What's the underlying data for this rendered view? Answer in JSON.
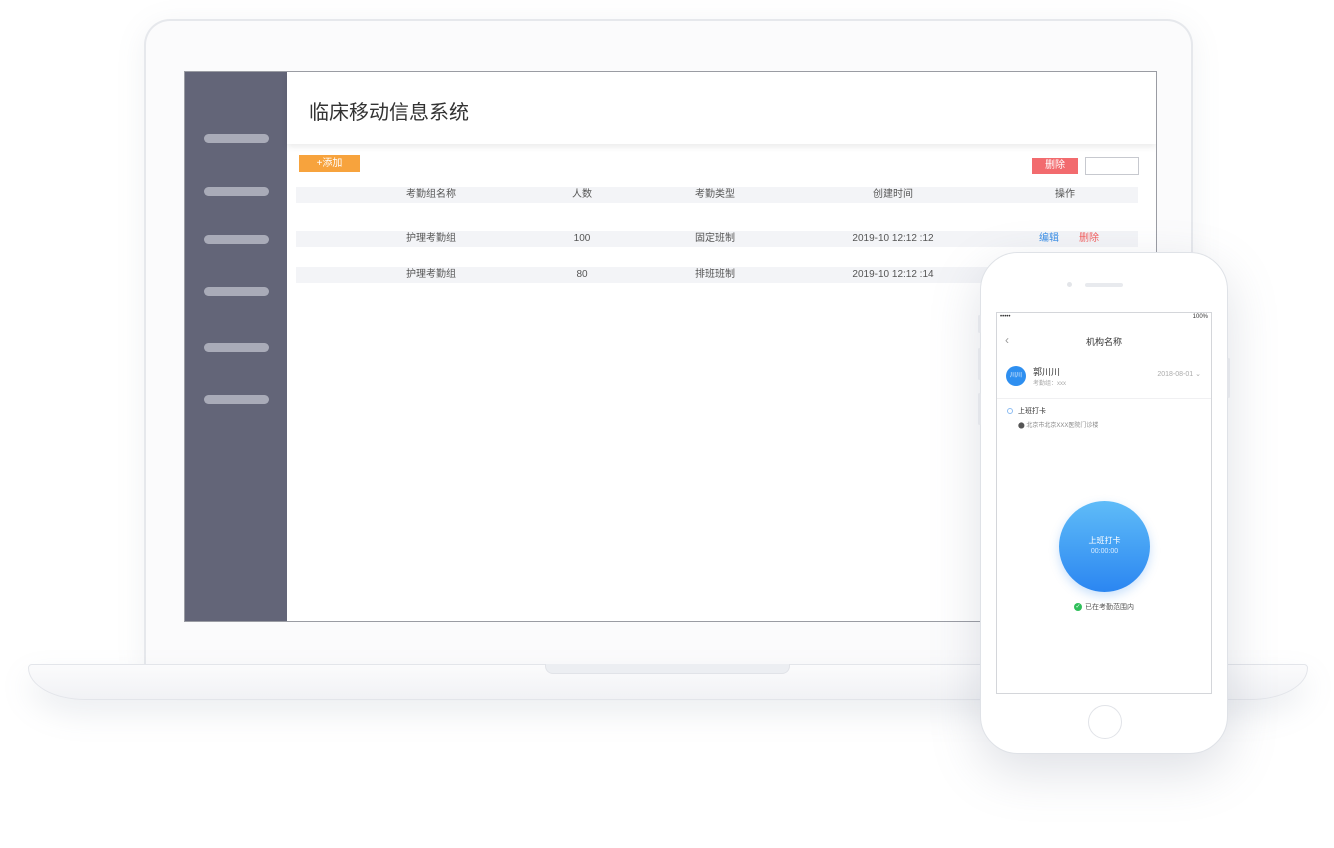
{
  "app": {
    "title": "临床移动信息系统",
    "add_button": "+添加",
    "delete_button": "删除",
    "search_placeholder": ""
  },
  "table": {
    "headers": [
      "考勤组名称",
      "人数",
      "考勤类型",
      "创建时间",
      "操作"
    ],
    "rows": [
      {
        "name": "护理考勤组",
        "count": "100",
        "type": "固定班制",
        "created": "2019-10 12:12 :12",
        "edit": "编辑",
        "delete": "删除"
      },
      {
        "name": "护理考勤组",
        "count": "80",
        "type": "排班班制",
        "created": "2019-10 12:12 :14"
      }
    ]
  },
  "phone": {
    "signal": "•••••",
    "battery": "100%",
    "title": "机构名称",
    "avatar_text": "川川",
    "user_name": "郭川川",
    "group": "考勤组：xxx",
    "date": "2018-08-01",
    "clock_in_label": "上班打卡",
    "location": "北京市北京XXX医院门诊楼",
    "button_label": "上班打卡",
    "button_time": "00:00:00",
    "range_status": "已在考勤范围内"
  },
  "colors": {
    "sidebar": "#636578",
    "add_button": "#f7a33d",
    "delete_button": "#f26b6e",
    "edit_link": "#3a8ee6",
    "clock_button": "#2b86f1",
    "in_range": "#2fbf5a"
  }
}
